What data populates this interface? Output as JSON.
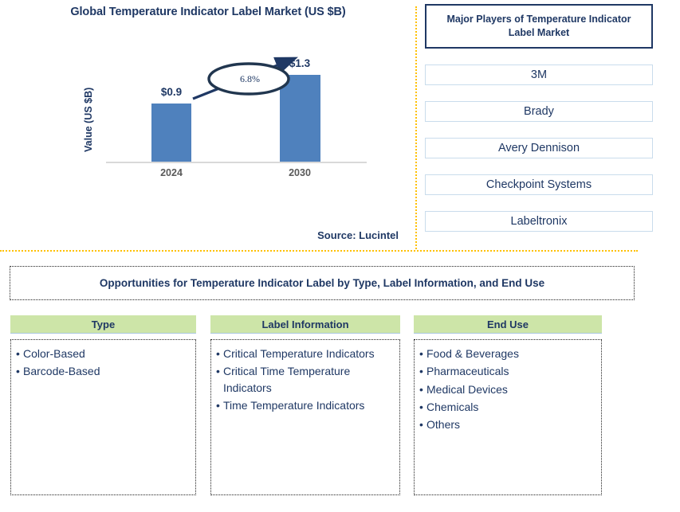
{
  "chart_panel": {
    "title": "Global Temperature Indicator Label Market (US $B)",
    "y_axis_label": "Value (US $B)",
    "source": "Source: Lucintel",
    "cagr_label": "6.8%"
  },
  "chart_data": {
    "type": "bar",
    "title": "Global Temperature Indicator Label Market (US $B)",
    "xlabel": "",
    "ylabel": "Value (US $B)",
    "categories": [
      "2024",
      "2030"
    ],
    "values": [
      0.9,
      1.3
    ],
    "value_labels": [
      "$0.9",
      "$1.3"
    ],
    "ylim": [
      0,
      1.55
    ],
    "grid": false,
    "legend": "none",
    "annotations": [
      {
        "text": "6.8%",
        "kind": "cagr-ellipse-arrow",
        "from": "2024",
        "to": "2030"
      }
    ],
    "source": "Source: Lucintel"
  },
  "players": {
    "header": "Major Players of Temperature Indicator Label Market",
    "items": [
      "3M",
      "Brady",
      "Avery Dennison",
      "Checkpoint Systems",
      "Labeltronix"
    ]
  },
  "opportunities": {
    "banner": "Opportunities for Temperature Indicator Label by Type, Label Information, and End Use",
    "columns": [
      {
        "header": "Type",
        "items": [
          "Color-Based",
          "Barcode-Based"
        ]
      },
      {
        "header": "Label Information",
        "items": [
          "Critical Temperature Indicators",
          "Critical Time Temperature Indicators",
          "Time Temperature Indicators"
        ]
      },
      {
        "header": "End Use",
        "items": [
          "Food & Beverages",
          "Pharmaceuticals",
          "Medical Devices",
          "Chemicals",
          "Others"
        ]
      }
    ]
  },
  "colors": {
    "bar": "#4F81BD",
    "navy_text": "#1F3864",
    "green_header": "#CDE5A8",
    "divider_orange": "#FFC000",
    "tick_gray": "#595959",
    "player_border": "#C9DCEC"
  },
  "bullet_glyph": "•"
}
